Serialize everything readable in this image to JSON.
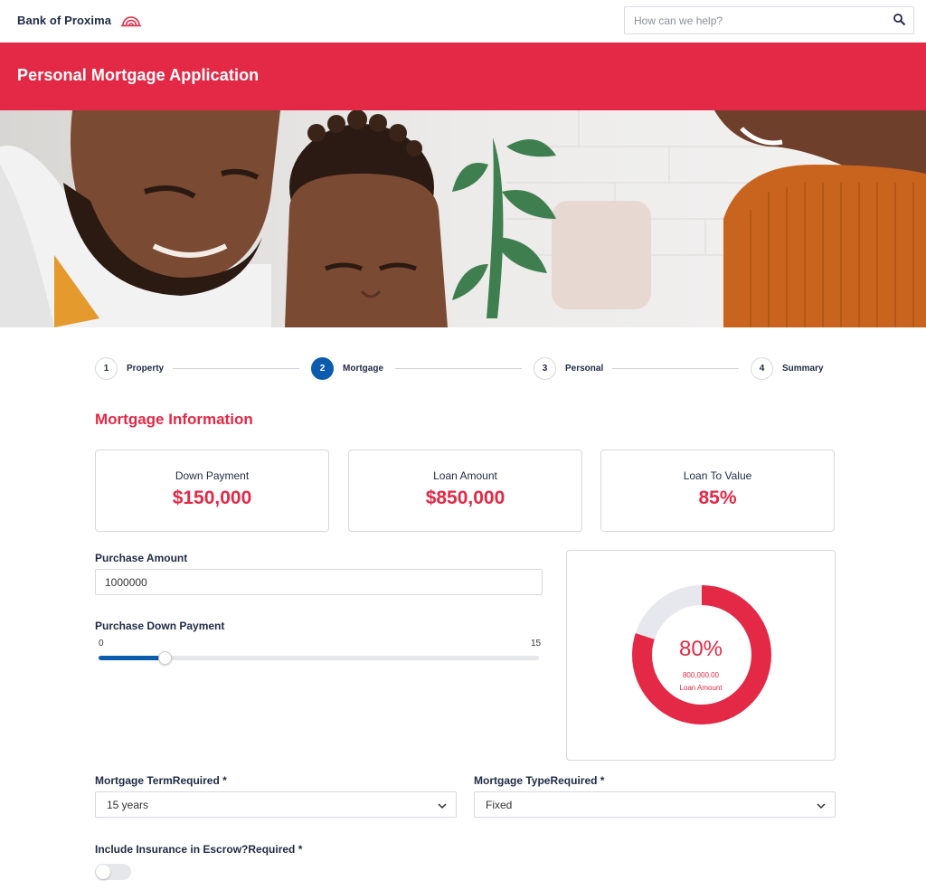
{
  "brand": {
    "name": "Bank of Proxima",
    "accent": "#e32946",
    "primary": "#0b5cad"
  },
  "search": {
    "placeholder": "How can we help?",
    "icon": "search-icon"
  },
  "header": {
    "title": "Personal Mortgage Application"
  },
  "hero": {
    "description_icon": "family-photo"
  },
  "stepper": {
    "steps": [
      {
        "number": "1",
        "label": "Property",
        "active": false
      },
      {
        "number": "2",
        "label": "Mortgage",
        "active": true
      },
      {
        "number": "3",
        "label": "Personal",
        "active": false
      },
      {
        "number": "4",
        "label": "Summary",
        "active": false
      }
    ]
  },
  "section": {
    "title": "Mortgage Information"
  },
  "summary_cards": [
    {
      "label": "Down Payment",
      "value": "$150,000"
    },
    {
      "label": "Loan Amount",
      "value": "$850,000"
    },
    {
      "label": "Loan To Value",
      "value": "85%"
    }
  ],
  "purchase_amount": {
    "label": "Purchase Amount",
    "value": "1000000"
  },
  "down_payment_slider": {
    "label": "Purchase Down Payment",
    "min": "0",
    "max": "15",
    "value_fraction": 0.15
  },
  "donut": {
    "percent_text": "80%",
    "percent_value": 80,
    "amount": "800,000.00",
    "caption": "Loan Amount"
  },
  "mortgage_term": {
    "label": "Mortgage TermRequired *",
    "value": "15 years"
  },
  "mortgage_type": {
    "label": "Mortgage TypeRequired *",
    "value": "Fixed"
  },
  "escrow": {
    "label": "Include Insurance in Escrow?Required *",
    "checked": false
  }
}
